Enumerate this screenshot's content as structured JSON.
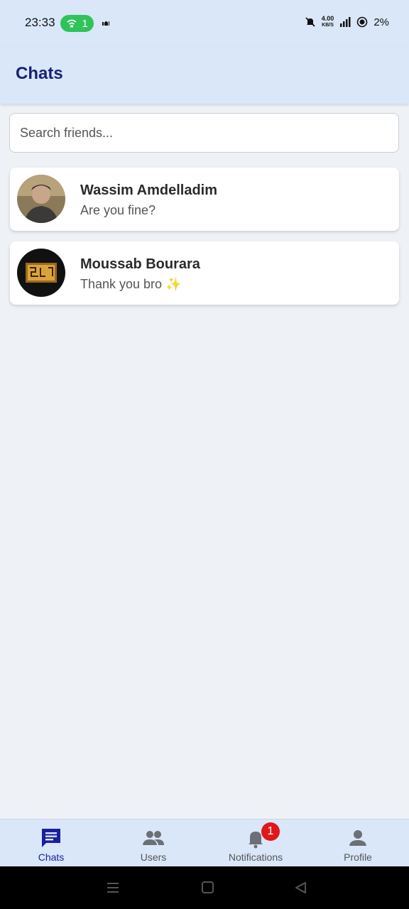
{
  "status_bar": {
    "time": "23:33",
    "hotspot_count": "1",
    "net_speed_value": "4.00",
    "net_speed_unit": "KB/S",
    "battery": "2%"
  },
  "app_bar": {
    "title": "Chats"
  },
  "search": {
    "placeholder": "Search friends..."
  },
  "chats": [
    {
      "name": "Wassim Amdelladim",
      "last_message": "Are you fine?"
    },
    {
      "name": "Moussab Bourara",
      "last_message": "Thank you bro ✨"
    }
  ],
  "bottom_nav": {
    "items": [
      {
        "label": "Chats",
        "icon": "chat-icon",
        "active": true
      },
      {
        "label": "Users",
        "icon": "users-icon",
        "active": false
      },
      {
        "label": "Notifications",
        "icon": "bell-icon",
        "active": false,
        "badge": "1"
      },
      {
        "label": "Profile",
        "icon": "person-icon",
        "active": false
      }
    ]
  },
  "colors": {
    "bar_background": "#d9e7f8",
    "title": "#1a1f7a",
    "active_nav": "#1a1fa0",
    "badge": "#e0181c",
    "hotspot_pill": "#2fc35a"
  }
}
